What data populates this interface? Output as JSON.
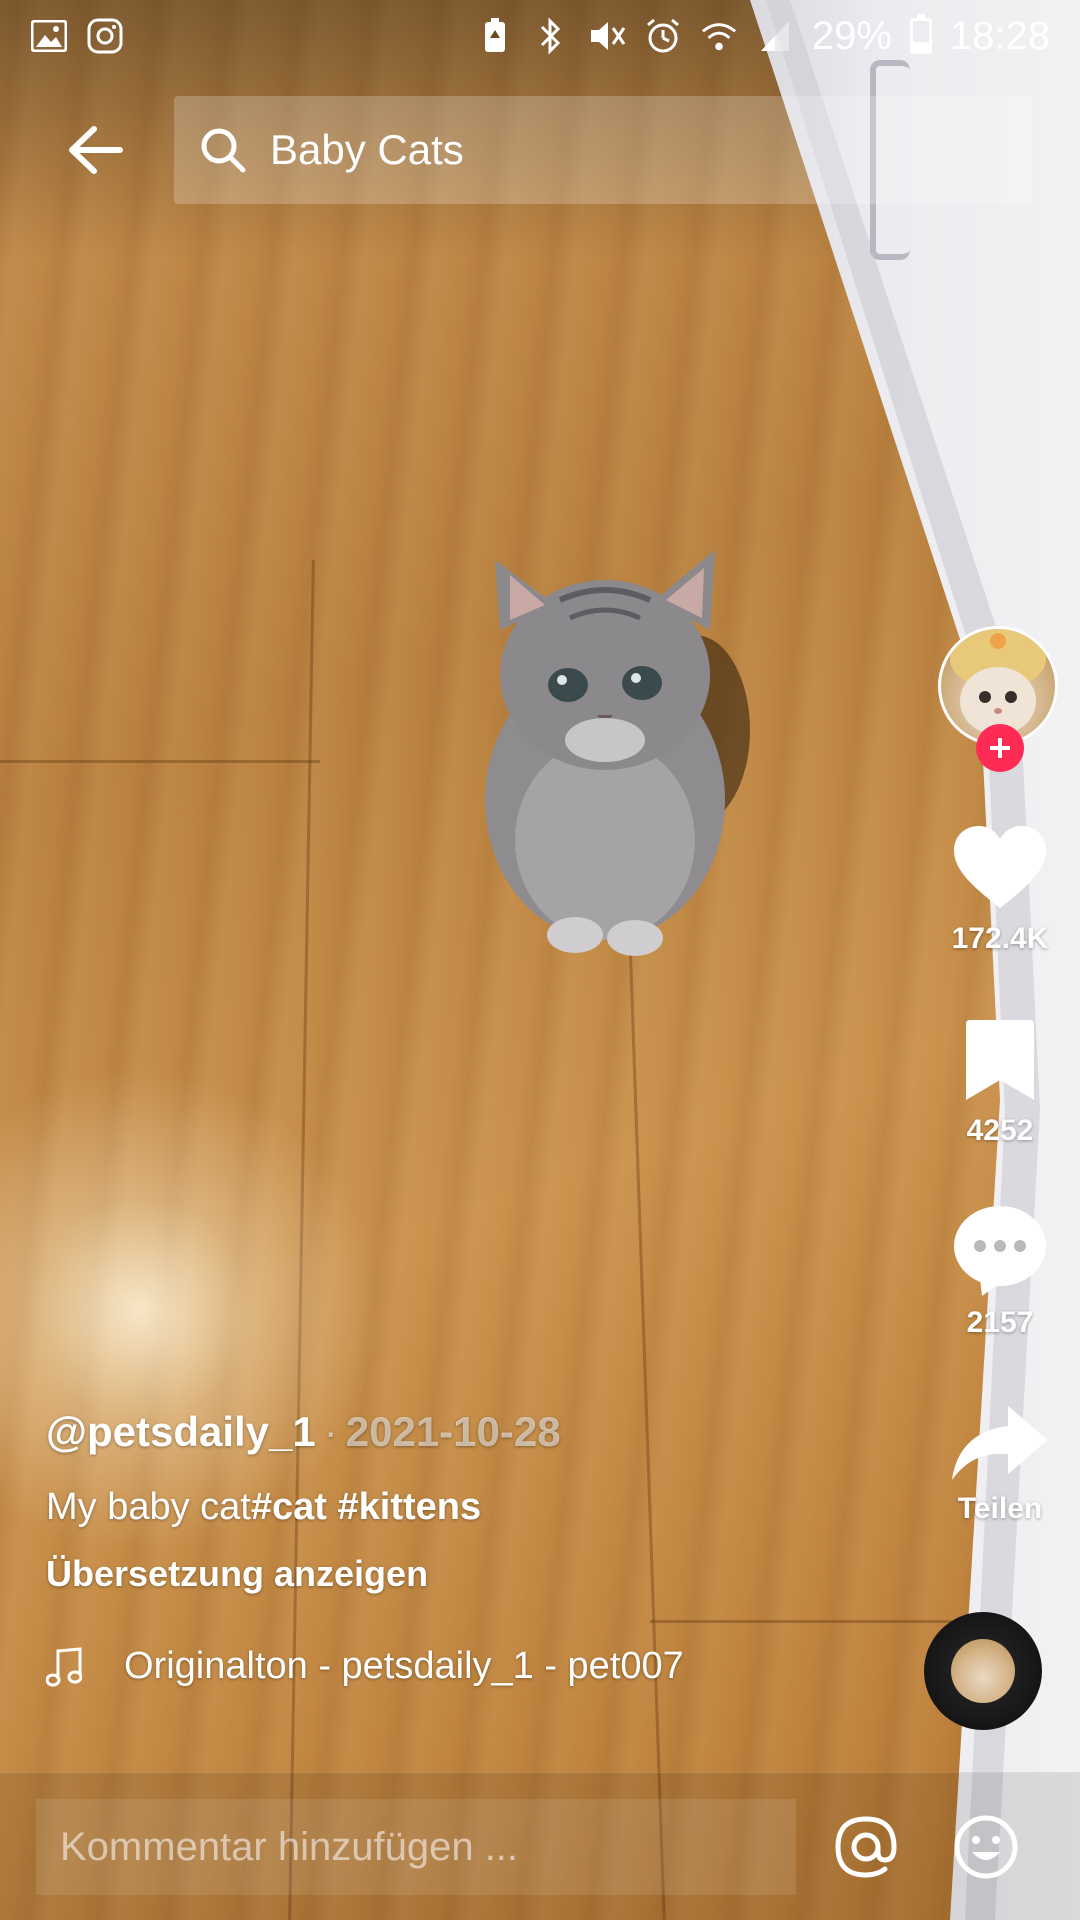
{
  "status_bar": {
    "battery_percent": "29%",
    "battery_level": 0.29,
    "time": "18:28",
    "left_icons": [
      "gallery-icon",
      "instagram-icon"
    ],
    "right_icons": [
      "battery-saver-icon",
      "bluetooth-icon",
      "mute-icon",
      "alarm-icon",
      "wifi-icon",
      "signal-icon"
    ]
  },
  "header": {
    "back_icon": "arrow-left-icon",
    "search_query": "Baby Cats",
    "search_icon": "search-icon"
  },
  "rail": {
    "follow_icon": "plus-icon",
    "like": {
      "icon": "heart-icon",
      "count": "172.4K"
    },
    "bookmark": {
      "icon": "bookmark-icon",
      "count": "4252"
    },
    "comments": {
      "icon": "comment-bubble-icon",
      "count": "2157"
    },
    "share": {
      "icon": "share-arrow-icon",
      "label": "Teilen"
    }
  },
  "post": {
    "username": "@petsdaily_1",
    "separator": "·",
    "date": "2021-10-28",
    "description_text": "My baby cat",
    "hashtags": [
      "#cat",
      "#kittens"
    ],
    "translate_label": "Übersetzung anzeigen",
    "music_icon": "music-note-icon",
    "music": "Originalton - petsdaily_1 - pet007"
  },
  "comment_bar": {
    "placeholder": "Kommentar hinzufügen ...",
    "mention_icon": "at-icon",
    "emoji_icon": "emoji-icon"
  },
  "colors": {
    "accent": "#fe2c55",
    "text": "#ffffff"
  }
}
